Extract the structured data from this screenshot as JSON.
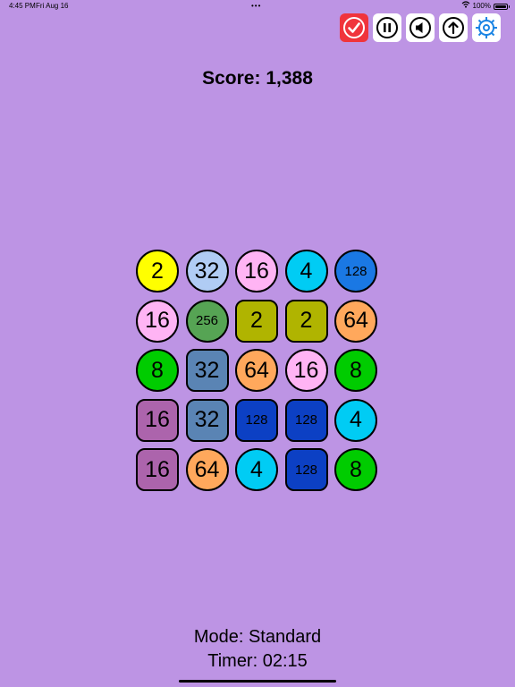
{
  "status_bar": {
    "time": "4:45 PM",
    "date": "Fri Aug 16",
    "dots": "•••",
    "wifi_icon": "wifi-icon",
    "battery_text": "100%",
    "battery_level": 1.0
  },
  "toolbar": {
    "buttons": [
      {
        "id": "check",
        "icon": "checkmark-icon",
        "color": "#f0343c"
      },
      {
        "id": "pause",
        "icon": "pause-icon",
        "color": "#ffffff"
      },
      {
        "id": "sound",
        "icon": "speaker-icon",
        "color": "#ffffff"
      },
      {
        "id": "up",
        "icon": "arrow-up-icon",
        "color": "#ffffff"
      },
      {
        "id": "settings",
        "icon": "gear-icon",
        "color": "#ffffff"
      }
    ]
  },
  "score": {
    "text": "Score: 1,388"
  },
  "board": {
    "rows": [
      [
        {
          "value": "2",
          "shape": "circle",
          "color": "#ffff00"
        },
        {
          "value": "32",
          "shape": "circle",
          "color": "#b0ccf4"
        },
        {
          "value": "16",
          "shape": "circle",
          "color": "#ffb4f4"
        },
        {
          "value": "4",
          "shape": "circle",
          "color": "#00ccf4"
        },
        {
          "value": "128",
          "shape": "circle",
          "color": "#1a78e4"
        }
      ],
      [
        {
          "value": "16",
          "shape": "circle",
          "color": "#ffb4f4"
        },
        {
          "value": "256",
          "shape": "circle",
          "color": "#56a454"
        },
        {
          "value": "2",
          "shape": "square",
          "color": "#b0b400"
        },
        {
          "value": "2",
          "shape": "square",
          "color": "#b0b400"
        },
        {
          "value": "64",
          "shape": "circle",
          "color": "#ffa85c"
        }
      ],
      [
        {
          "value": "8",
          "shape": "circle",
          "color": "#00cc00"
        },
        {
          "value": "32",
          "shape": "square",
          "color": "#5a84b4"
        },
        {
          "value": "64",
          "shape": "circle",
          "color": "#ffa85c"
        },
        {
          "value": "16",
          "shape": "circle",
          "color": "#ffb4f4"
        },
        {
          "value": "8",
          "shape": "circle",
          "color": "#00cc00"
        }
      ],
      [
        {
          "value": "16",
          "shape": "square",
          "color": "#ac64ac"
        },
        {
          "value": "32",
          "shape": "square",
          "color": "#5a84b4"
        },
        {
          "value": "128",
          "shape": "square",
          "color": "#0c40c4"
        },
        {
          "value": "128",
          "shape": "square",
          "color": "#0c40c4"
        },
        {
          "value": "4",
          "shape": "circle",
          "color": "#00ccf4"
        }
      ],
      [
        {
          "value": "16",
          "shape": "square",
          "color": "#ac64ac"
        },
        {
          "value": "64",
          "shape": "circle",
          "color": "#ffa85c"
        },
        {
          "value": "4",
          "shape": "circle",
          "color": "#00ccf4"
        },
        {
          "value": "128",
          "shape": "square",
          "color": "#0c40c4"
        },
        {
          "value": "8",
          "shape": "circle",
          "color": "#00cc00"
        }
      ]
    ]
  },
  "footer": {
    "mode": "Mode: Standard",
    "timer": "Timer: 02:15"
  },
  "colors": {
    "background": "#bd94e4",
    "settings_accent": "#1a84e4"
  }
}
